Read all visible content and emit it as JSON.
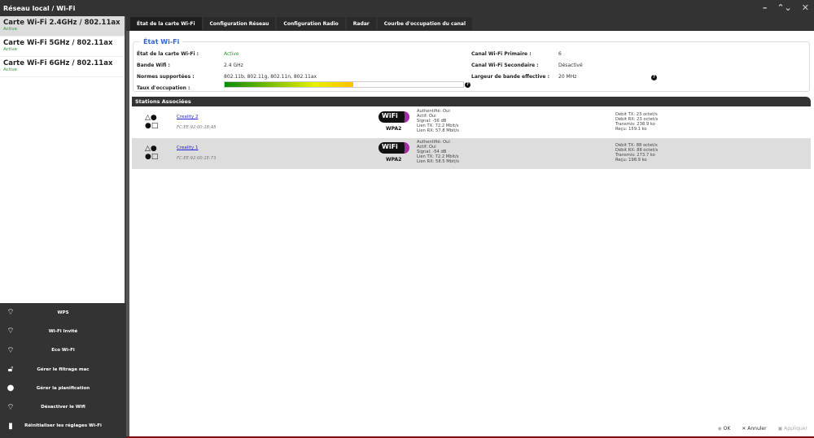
{
  "title": "Réseau local / Wi-Fi",
  "window": {
    "minimize": "–",
    "restore": "⌃⌄",
    "close": "✕"
  },
  "cards": [
    {
      "title": "Carte Wi-Fi 2.4GHz / 802.11ax",
      "status": "Active"
    },
    {
      "title": "Carte Wi-Fi 5GHz / 802.11ax",
      "status": "Active"
    },
    {
      "title": "Carte Wi-Fi 6GHz / 802.11ax",
      "status": "Active"
    }
  ],
  "actions": [
    {
      "icon": "wps-icon",
      "label": "WPS"
    },
    {
      "icon": "wifi-icon",
      "label": "Wi-Fi Invité"
    },
    {
      "icon": "eco-wifi-icon",
      "label": "Eco Wi-Fi"
    },
    {
      "icon": "lock-icon",
      "label": "Gérer le filtrage mac"
    },
    {
      "icon": "clock-icon",
      "label": "Gérer la planification"
    },
    {
      "icon": "wifi-icon",
      "label": "Désactiver le Wifi"
    },
    {
      "icon": "trash-icon",
      "label": "Réinitialiser les réglages Wi-Fi"
    }
  ],
  "tabs": [
    "État de la carte Wi-Fi",
    "Configuration Réseau",
    "Configuration Radio",
    "Radar",
    "Courbe d'occupation du canal"
  ],
  "status": {
    "legend": "État Wi-Fi",
    "state_label": "État de la carte Wi-Fi :",
    "state": "Active",
    "band_label": "Bande Wifi :",
    "band": "2.4 GHz",
    "norms_label": "Normes supportées :",
    "norms": "802.11b, 802.11g, 802.11n, 802.11ax",
    "occupation_label": "Taux d'occupation :",
    "occupation_percent": 54,
    "primary_label": "Canal Wi-Fi Primaire :",
    "primary": "6",
    "secondary_label": "Canal Wi-Fi Secondaire :",
    "secondary": "Désactivé",
    "width_label": "Largeur de bande effective :",
    "width": "20 MHz",
    "help": "?"
  },
  "stations": {
    "title": "Stations Associées",
    "list": [
      {
        "name": "Creality 2",
        "mac": "FC:EE:92:00:18:A5",
        "security": "WPA2",
        "auth": "Authentifié: Oui",
        "active": "Actif: Oui",
        "signal": "Signal: -56 dB",
        "tx": "Lien TX: 72.2 Mbit/s",
        "rx": "Lien RX: 57.8 Mbit/s",
        "dtx": "Débit TX: 23 octet/s",
        "drx": "Débit RX: 23 octet/s",
        "sent": "Transmis: 238.9 ko",
        "recv": "Reçu: 159.1 ko"
      },
      {
        "name": "Creality 1",
        "mac": "FC:EE:92:00:1E:73",
        "security": "WPA2",
        "auth": "Authentifié: Oui",
        "active": "Actif: Oui",
        "signal": "Signal: -54 dB",
        "tx": "Lien TX: 72.2 Mbit/s",
        "rx": "Lien RX: 58.5 Mbit/s",
        "dtx": "Débit TX: 88 octet/s",
        "drx": "Débit RX: 88 octet/s",
        "sent": "Transmis: 273.7 ko",
        "recv": "Reçu: 198.9 ko"
      }
    ]
  },
  "wifi_logo": "WiFi",
  "footer": {
    "ok": "OK",
    "cancel": "Annuler",
    "apply": "Appliquer"
  }
}
